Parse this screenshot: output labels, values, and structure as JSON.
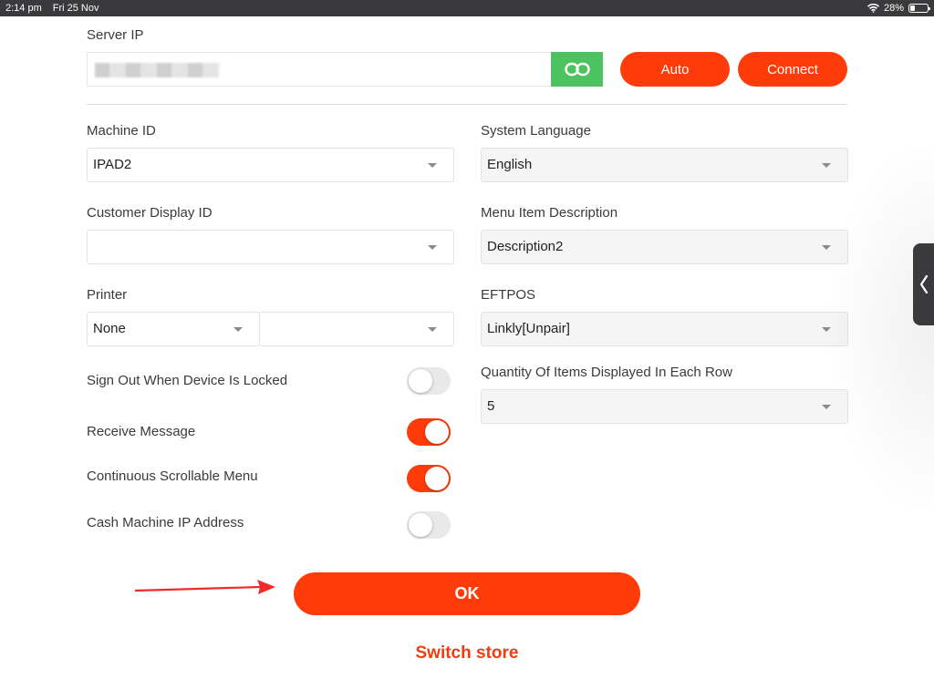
{
  "status_bar": {
    "time": "2:14 pm",
    "date": "Fri 25 Nov",
    "battery": "28%",
    "battery_level": 0.28
  },
  "server_ip": {
    "label": "Server IP",
    "value": "",
    "auto_label": "Auto",
    "connect_label": "Connect"
  },
  "machine_id": {
    "label": "Machine ID",
    "value": "IPAD2"
  },
  "system_language": {
    "label": "System Language",
    "value": "English"
  },
  "customer_display_id": {
    "label": "Customer Display ID",
    "value": ""
  },
  "menu_item_description": {
    "label": "Menu Item Description",
    "value": "Description2"
  },
  "printer": {
    "label": "Printer",
    "value": "None",
    "second_value": ""
  },
  "eftpos": {
    "label": "EFTPOS",
    "value": "Linkly[Unpair]"
  },
  "quantity_per_row": {
    "label": "Quantity Of Items Displayed In Each Row",
    "value": "5"
  },
  "toggles": {
    "sign_out": {
      "label": "Sign Out When Device Is Locked",
      "on": false
    },
    "receive_message": {
      "label": "Receive Message",
      "on": true
    },
    "continuous_menu": {
      "label": "Continuous Scrollable Menu",
      "on": true
    },
    "cash_machine_ip": {
      "label": "Cash Machine IP Address",
      "on": false
    }
  },
  "ok_label": "OK",
  "switch_store_label": "Switch store",
  "colors": {
    "accent": "#ff3b0a",
    "link_button": "#4cc261",
    "toggle_off": "#e9e9ea",
    "status_bar": "#3a3a3c"
  }
}
